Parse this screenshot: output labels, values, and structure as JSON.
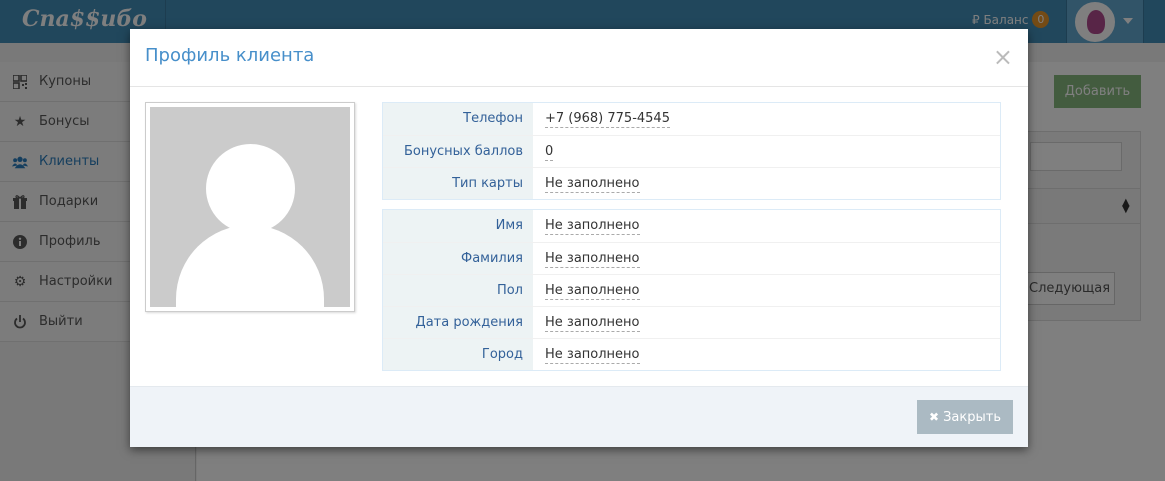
{
  "app": {
    "logo_text": "Спа$$ибо",
    "balance_label": "₽ Баланс",
    "balance_count": "0"
  },
  "sidebar": {
    "items": [
      {
        "label": "Купоны",
        "icon": "qrcode-icon"
      },
      {
        "label": "Бонусы",
        "icon": "star-icon"
      },
      {
        "label": "Клиенты",
        "icon": "users-icon",
        "active": true
      },
      {
        "label": "Подарки",
        "icon": "gift-icon"
      },
      {
        "label": "Профиль",
        "icon": "info-icon"
      },
      {
        "label": "Настройки",
        "icon": "gear-icon"
      },
      {
        "label": "Выйти",
        "icon": "power-icon"
      }
    ]
  },
  "background": {
    "add_button": "Добавить",
    "next_button": "Следующая"
  },
  "modal": {
    "title": "Профиль клиента",
    "close_symbol": "×",
    "card_info": [
      {
        "label": "Телефон",
        "value": "+7 (968) 775-4545"
      },
      {
        "label": "Бонусных баллов",
        "value": "0"
      },
      {
        "label": "Тип карты",
        "value": "Не заполнено"
      }
    ],
    "personal_info": [
      {
        "label": "Имя",
        "value": "Не заполнено"
      },
      {
        "label": "Фамилия",
        "value": "Не заполнено"
      },
      {
        "label": "Пол",
        "value": "Не заполнено"
      },
      {
        "label": "Дата рождения",
        "value": "Не заполнено"
      },
      {
        "label": "Город",
        "value": "Не заполнено"
      }
    ],
    "footer": {
      "close_button": "Закрыть"
    }
  },
  "colors": {
    "topbar": "#438eb9",
    "accent": "#478fca",
    "add_button": "#87b87f",
    "close_button": "#abbac3"
  }
}
